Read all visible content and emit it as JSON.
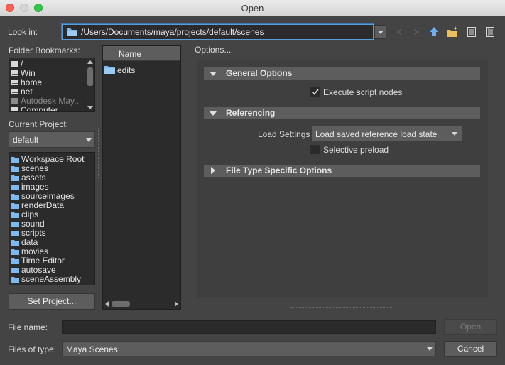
{
  "window": {
    "title": "Open"
  },
  "lookin": {
    "label": "Look in:",
    "path": "/Users/Documents/maya/projects/default/scenes"
  },
  "bookmarks": {
    "label": "Folder Bookmarks:",
    "items": [
      {
        "label": "/",
        "icon": "drive-icon"
      },
      {
        "label": "Win",
        "icon": "drive-icon"
      },
      {
        "label": "home",
        "icon": "drive-icon"
      },
      {
        "label": "net",
        "icon": "drive-icon"
      },
      {
        "label": "Autodesk May...",
        "icon": "drive-icon",
        "dimmed": true
      },
      {
        "label": "Computer",
        "icon": "computer-icon"
      }
    ]
  },
  "project": {
    "label": "Current Project:",
    "value": "default",
    "folders": [
      "Workspace Root",
      "scenes",
      "assets",
      "images",
      "sourceimages",
      "renderData",
      "clips",
      "sound",
      "scripts",
      "data",
      "movies",
      "Time Editor",
      "autosave",
      "sceneAssembly"
    ],
    "set_button": "Set Project..."
  },
  "files": {
    "column_header": "Name",
    "items": [
      {
        "label": "edits",
        "icon": "folder-icon"
      }
    ]
  },
  "options": {
    "label": "Options...",
    "general": {
      "title": "General Options",
      "execute_script": "Execute script nodes",
      "execute_checked": true
    },
    "referencing": {
      "title": "Referencing",
      "load_settings_label": "Load Settings",
      "load_settings_value": "Load saved reference load state",
      "selective_preload": "Selective preload",
      "selective_checked": false
    },
    "filetype": {
      "title": "File Type Specific Options"
    }
  },
  "footer": {
    "filename_label": "File name:",
    "filename_value": "",
    "filetype_label": "Files of type:",
    "filetype_value": "Maya Scenes",
    "open_button": "Open",
    "cancel_button": "Cancel"
  },
  "colors": {
    "accent": "#5b9bd9",
    "folder": "#7fb8ee",
    "panel_bg": "#2b2b2b",
    "window_bg": "#444444"
  }
}
